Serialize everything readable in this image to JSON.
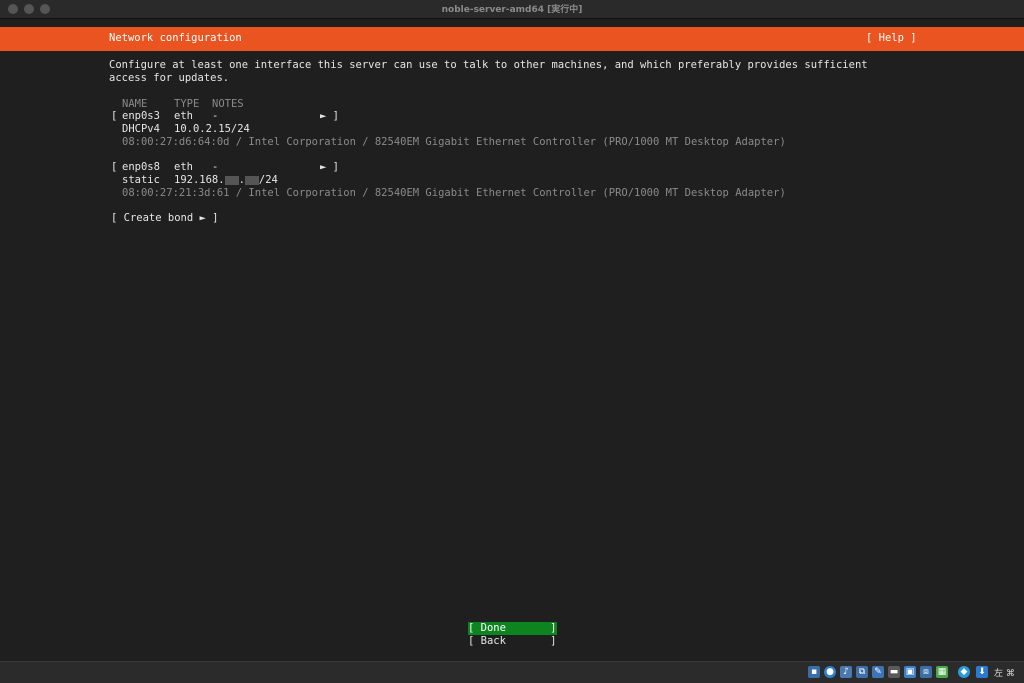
{
  "window": {
    "title": "noble-server-amd64 [実行中]"
  },
  "header": {
    "title": "Network configuration",
    "help": "[ Help ]"
  },
  "intro": {
    "line1": "Configure at least one interface this server can use to talk to other machines, and which preferably provides sufficient",
    "line2": "access for updates."
  },
  "table": {
    "columns": [
      "NAME",
      "TYPE",
      "NOTES"
    ],
    "interfaces": [
      {
        "open": "[",
        "name": "enp0s3",
        "type": "eth",
        "notes": "-",
        "close": "► ]",
        "addr_type": "DHCPv4",
        "address": "10.0.2.15/24",
        "mac_info": "08:00:27:d6:64:0d / Intel Corporation / 82540EM Gigabit Ethernet Controller (PRO/1000 MT Desktop Adapter)"
      },
      {
        "open": "[",
        "name": "enp0s8",
        "type": "eth",
        "notes": "-",
        "close": "► ]",
        "addr_type": "static",
        "address_prefix": "192.168.",
        "address_sep": ".",
        "address_suffix": "/24",
        "mac_info": "08:00:27:21:3d:61 / Intel Corporation / 82540EM Gigabit Ethernet Controller (PRO/1000 MT Desktop Adapter)"
      }
    ]
  },
  "create_bond": "[ Create bond ► ]",
  "buttons": {
    "done": "[ Done       ]",
    "back": "[ Back       ]"
  },
  "statusbar": {
    "host_key": "左 ⌘",
    "icons": [
      "hdd-icon",
      "optical-icon",
      "audio-icon",
      "network-icon",
      "usb-icon",
      "shared-folder-icon",
      "display-icon",
      "recording-icon",
      "cpu-icon",
      "mouse-icon",
      "keyboard-icon"
    ],
    "colors": {
      "accent": "#e95420",
      "done_bg": "#0e8420"
    }
  }
}
